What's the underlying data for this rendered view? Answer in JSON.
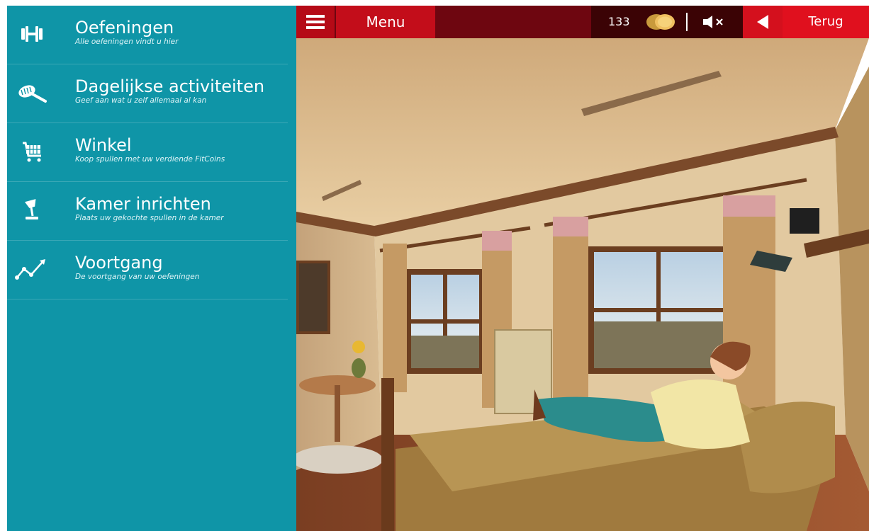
{
  "sidebar": {
    "items": [
      {
        "title": "Oefeningen",
        "subtitle": "Alle oefeningen vindt u hier",
        "icon": "dumbbell-icon"
      },
      {
        "title": "Dagelijkse activiteiten",
        "subtitle": "Geef aan wat u zelf allemaal al kan",
        "icon": "hairbrush-icon"
      },
      {
        "title": "Winkel",
        "subtitle": "Koop spullen met uw verdiende FitCoins",
        "icon": "shopping-cart-icon"
      },
      {
        "title": "Kamer inrichten",
        "subtitle": "Plaats uw gekochte spullen in de kamer",
        "icon": "lamp-icon"
      },
      {
        "title": "Voortgang",
        "subtitle": "De voortgang van uw oefeningen",
        "icon": "trend-graph-icon"
      }
    ]
  },
  "topbar": {
    "menu_label": "Menu",
    "coins": "133",
    "back_label": "Terug",
    "menu_icon": "hamburger-icon",
    "coin_icon": "coins-icon",
    "sound_icon": "speaker-muted-icon",
    "back_icon": "back-arrow-icon"
  },
  "colors": {
    "sidebar": "#0f95a7",
    "topbar": "#6e0610",
    "accent_red": "#e0101e"
  }
}
